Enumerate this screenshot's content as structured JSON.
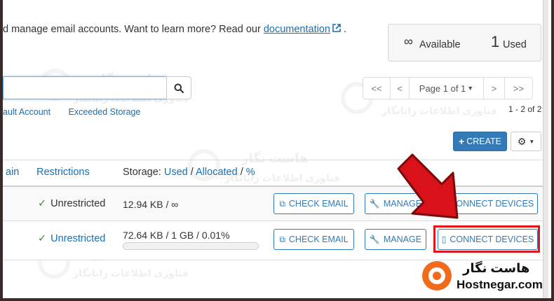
{
  "intro": {
    "text": "d manage email accounts. Want to learn more? Read our",
    "link": "documentation",
    "suffix": "."
  },
  "stats": {
    "available_symbol": "∞",
    "available_label": "Available",
    "used_count": "1",
    "used_label": "Used"
  },
  "search": {
    "value": ""
  },
  "filters": [
    "ault Account",
    "Exceeded Storage"
  ],
  "pagination": {
    "first": "<<",
    "prev": "<",
    "page_label": "Page 1 of 1",
    "next": ">",
    "last": ">>",
    "count": "1 - 2 of 2"
  },
  "toolbar": {
    "create_label": "CREATE"
  },
  "table": {
    "headers": {
      "domain": "ain",
      "restrictions": "Restrictions",
      "storage_prefix": "Storage:",
      "storage_used": "Used",
      "storage_sep1": " / ",
      "storage_allocated": "Allocated",
      "storage_sep2": " / ",
      "storage_percent": "%"
    },
    "rows": [
      {
        "restriction": "Unrestricted",
        "storage": "12.94 KB / ∞",
        "check_email": "CHECK EMAIL",
        "manage": "MANAGE",
        "connect": "CONNECT DEVICES"
      },
      {
        "restriction": "Unrestricted",
        "storage": "72.64 KB / 1 GB / 0.01%",
        "storage_fraction": 0.0001,
        "check_email": "CHECK EMAIL",
        "manage": "MANAGE",
        "connect": "CONNECT DEVICES"
      }
    ]
  },
  "watermark": {
    "fa_title": "هاست نگار",
    "fa_subtitle": "فناوری اطلاعات رایانگار"
  },
  "logo": {
    "fa": "هاست نگار",
    "en": "Hostnegar.com",
    "color": "#f26b1d"
  },
  "colors": {
    "accent": "#337ab7",
    "link": "#1a6fb3",
    "highlight": "#e0161b",
    "arrow": "#d9121a",
    "check": "#3c8c3c"
  }
}
